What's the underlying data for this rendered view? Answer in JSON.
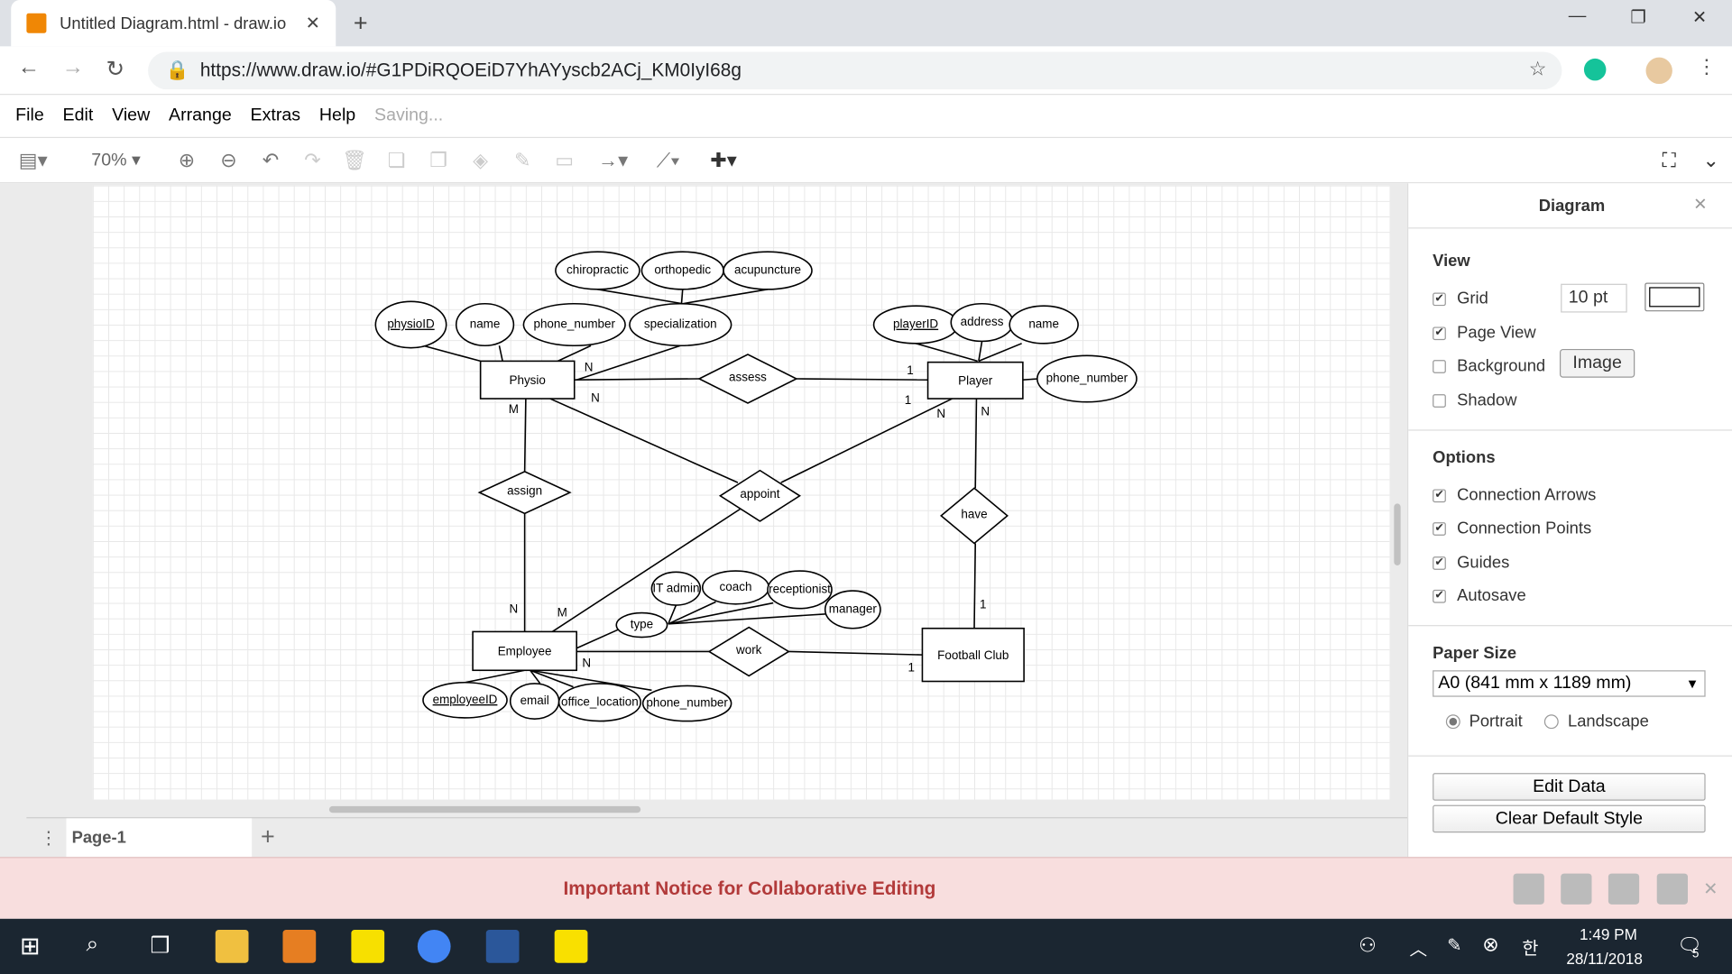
{
  "browser": {
    "tab_title": "Untitled Diagram.html - draw.io",
    "url": "https://www.draw.io/#G1PDiRQOEiD7YhAYyscb2ACj_KM0IyI68g"
  },
  "menu": {
    "items": [
      "File",
      "Edit",
      "View",
      "Arrange",
      "Extras",
      "Help"
    ],
    "status": "Saving..."
  },
  "toolbar": {
    "zoom": "70%"
  },
  "page_tab": "Page-1",
  "panel": {
    "title": "Diagram",
    "view_heading": "View",
    "grid": "Grid",
    "grid_size": "10 pt",
    "page_view": "Page View",
    "background": "Background",
    "image_button": "Image",
    "shadow": "Shadow",
    "options_heading": "Options",
    "connection_arrows": "Connection Arrows",
    "connection_points": "Connection Points",
    "guides": "Guides",
    "autosave": "Autosave",
    "paper_heading": "Paper Size",
    "paper_size": "A0 (841 mm x 1189 mm)",
    "portrait": "Portrait",
    "landscape": "Landscape",
    "edit_data": "Edit Data",
    "clear_style": "Clear Default Style",
    "checks": {
      "grid": true,
      "page_view": true,
      "background": false,
      "shadow": false,
      "connection_arrows": true,
      "connection_points": true,
      "guides": true,
      "autosave": true
    },
    "orientation": "portrait"
  },
  "notice": "Important Notice for Collaborative Editing",
  "clock": {
    "time": "1:49 PM",
    "date": "28/11/2018",
    "notifications": "5"
  },
  "diagram": {
    "entities": [
      "Physio",
      "Player",
      "Employee",
      "Football Club"
    ],
    "relationships": [
      "assess",
      "assign",
      "appoint",
      "have",
      "work"
    ],
    "attributes": [
      "chiropractic",
      "orthopedic",
      "acupuncture",
      "physioID",
      "name",
      "phone_number",
      "specialization",
      "playerID",
      "address",
      "name",
      "phone_number",
      "IT admin",
      "coach",
      "receptionist",
      "manager",
      "type",
      "employeeID",
      "email",
      "office_location",
      "phone_number"
    ],
    "key_attributes": [
      "physioID",
      "playerID",
      "employeeID"
    ],
    "cardinalities": [
      "N",
      "N",
      "M",
      "1",
      "1",
      "N",
      "N",
      "N",
      "M",
      "N",
      "1",
      "1"
    ]
  }
}
